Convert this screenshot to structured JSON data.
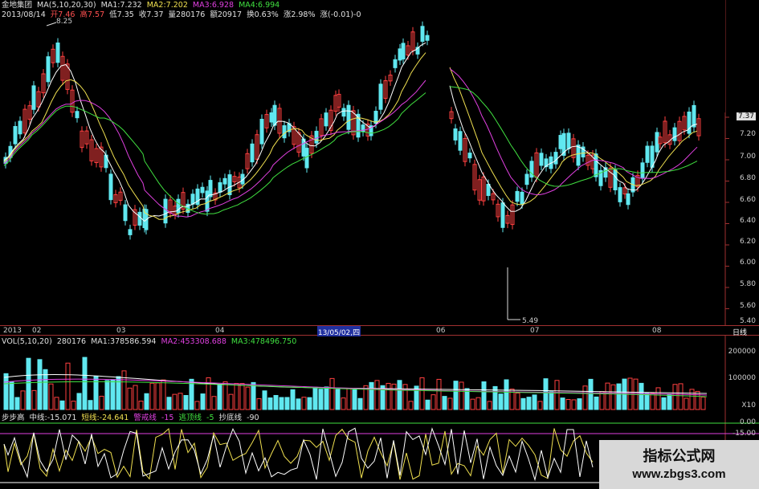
{
  "header": {
    "stock": "金地集团",
    "ma_label": "MA(5,10,20,30)",
    "ma1": "MA1:7.232",
    "ma2": "MA2:7.202",
    "ma3": "MA3:6.928",
    "ma4": "MA4:6.994",
    "date": "2013/08/14",
    "open": "开7.46",
    "high": "高7.57",
    "low": "低7.35",
    "close": "收7.37",
    "volume": "量280176",
    "amount": "额20917",
    "turnover": "换0.63%",
    "change": "涨2.98%",
    "diff": "涨(-0.01)-0"
  },
  "annotations": {
    "high_mark": "8.25",
    "low_mark": "5.49"
  },
  "price_axis": [
    "7.37",
    "7.20",
    "7.00",
    "6.80",
    "6.60",
    "6.40",
    "6.20",
    "6.00",
    "5.80",
    "5.60",
    "5.40"
  ],
  "date_axis": {
    "labels": [
      "2013",
      "02",
      "03",
      "04",
      "06",
      "07",
      "08"
    ],
    "cursor": "13/05/02,四",
    "period": "日线"
  },
  "volume": {
    "label": "VOL(5,10,20)",
    "value": "280176",
    "ma1": "MA1:378586.594",
    "ma2": "MA2:453308.688",
    "ma3": "MA3:478496.750",
    "axis": [
      "200000",
      "100000",
      "X10"
    ]
  },
  "indicator": {
    "name": "步步高",
    "mid": "中线:-15.071",
    "short": "短线:-24.641",
    "alert": "警戒线",
    "alert_val": "-15",
    "top": "逃顶线",
    "top_val": "-5",
    "bottom": "抄底线",
    "bottom_val": "-90",
    "axis": [
      "0.00",
      "-15.00"
    ]
  },
  "watermark": {
    "title": "指标公式网",
    "url": "www.zbgs3.com"
  },
  "colors": {
    "up": "#ff4040",
    "down": "#60e8f0",
    "ma5": "#ffffff",
    "ma10": "#f0e050",
    "ma20": "#e040e0",
    "ma30": "#40e040"
  }
}
